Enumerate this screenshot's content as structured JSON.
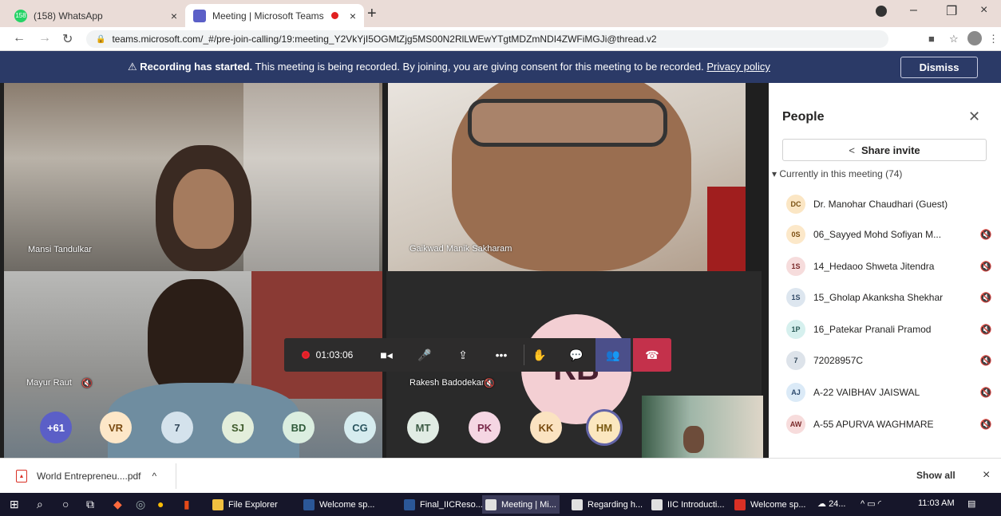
{
  "browser": {
    "tabs": [
      {
        "title": "(158) WhatsApp",
        "close": "×",
        "badge": "158"
      },
      {
        "title": "Meeting | Microsoft Teams",
        "close": "×"
      }
    ],
    "new_tab": "+",
    "window_controls": {
      "minimize": "–",
      "restore": "❐",
      "close": "×"
    },
    "url": "teams.microsoft.com/_#/pre-join-calling/19:meeting_Y2VkYjI5OGMtZjg5MS00N2RlLWEwYTgtMDZmNDI4ZWFiMGJi@thread.v2"
  },
  "banner": {
    "bold": "Recording has started.",
    "text": " This meeting is being recorded. By joining, you are giving consent for this meeting to be recorded. ",
    "link": "Privacy policy",
    "dismiss": "Dismiss"
  },
  "tiles": {
    "t1_name": "Mansi Tandulkar",
    "t2_name": "Gaikwad Manik Sakharam",
    "t3_name": "Mayur Raut",
    "t4_name": "Rakesh Badodekar",
    "t4_initials": "RB"
  },
  "controls": {
    "timer": "01:03:06"
  },
  "avatars": [
    {
      "label": "+61",
      "bg": "#5b5fc7",
      "fg": "#ffffff"
    },
    {
      "label": "VR",
      "bg": "#fde7c8",
      "fg": "#7a4b12"
    },
    {
      "label": "7",
      "bg": "#d4e2ec",
      "fg": "#33485a"
    },
    {
      "label": "SJ",
      "bg": "#e3eedb",
      "fg": "#3e5a2b"
    },
    {
      "label": "BD",
      "bg": "#dbeee0",
      "fg": "#2f5a3a"
    },
    {
      "label": "CG",
      "bg": "#d6ecef",
      "fg": "#2c5660"
    },
    {
      "label": "MT",
      "bg": "#e1ece4",
      "fg": "#3c5a44"
    },
    {
      "label": "PK",
      "bg": "#f5d6e3",
      "fg": "#7a2a4b"
    },
    {
      "label": "KK",
      "bg": "#fbe3c1",
      "fg": "#7a4d12"
    },
    {
      "label": "HM",
      "bg": "#fbe7bf",
      "fg": "#7a5a12"
    }
  ],
  "people": {
    "title": "People",
    "share_invite": "Share invite",
    "section": "Currently in this meeting (74)",
    "list": [
      {
        "initials": "DC",
        "name": "Dr. Manohar Chaudhari (Guest)",
        "muted": false,
        "bg": "#fbe6c4",
        "fg": "#7a5214"
      },
      {
        "initials": "0S",
        "name": "06_Sayyed Mohd Sofiyan M...",
        "muted": true,
        "bg": "#fce8c9",
        "fg": "#7a4d12"
      },
      {
        "initials": "1S",
        "name": "14_Hedaoo Shweta Jitendra",
        "muted": true,
        "bg": "#f6dcdc",
        "fg": "#7a2a2a"
      },
      {
        "initials": "1S",
        "name": "15_Gholap Akanksha Shekhar",
        "muted": true,
        "bg": "#dde6ef",
        "fg": "#324a66"
      },
      {
        "initials": "1P",
        "name": "16_Patekar Pranali Pramod",
        "muted": true,
        "bg": "#d6f0ee",
        "fg": "#2b5c58"
      },
      {
        "initials": "7",
        "name": "72028957C",
        "muted": true,
        "bg": "#dde3ea",
        "fg": "#33485a"
      },
      {
        "initials": "AJ",
        "name": "A-22 VAIBHAV JAISWAL",
        "muted": true,
        "bg": "#dbeaf7",
        "fg": "#2c4a6e"
      },
      {
        "initials": "AW",
        "name": "A-55 APURVA WAGHMARE",
        "muted": true,
        "bg": "#f7dcdc",
        "fg": "#7a2a2a"
      }
    ]
  },
  "downloads": {
    "file": "World Entrepreneu....pdf",
    "chevron": "^",
    "show_all": "Show all",
    "close": "×"
  },
  "taskbar": {
    "apps": [
      {
        "label": "File Explorer",
        "color": "#f0c040"
      },
      {
        "label": "Welcome sp...",
        "color": "#2b5797"
      },
      {
        "label": "Final_IICReso...",
        "color": "#2b5797"
      },
      {
        "label": "Meeting | Mi...",
        "color": "#e0e0e0"
      },
      {
        "label": "Regarding h...",
        "color": "#e0e0e0"
      },
      {
        "label": "IIC Introducti...",
        "color": "#e0e0e0"
      },
      {
        "label": "Welcome sp...",
        "color": "#d93025"
      }
    ],
    "weather": "24...",
    "time": "11:03 AM"
  }
}
